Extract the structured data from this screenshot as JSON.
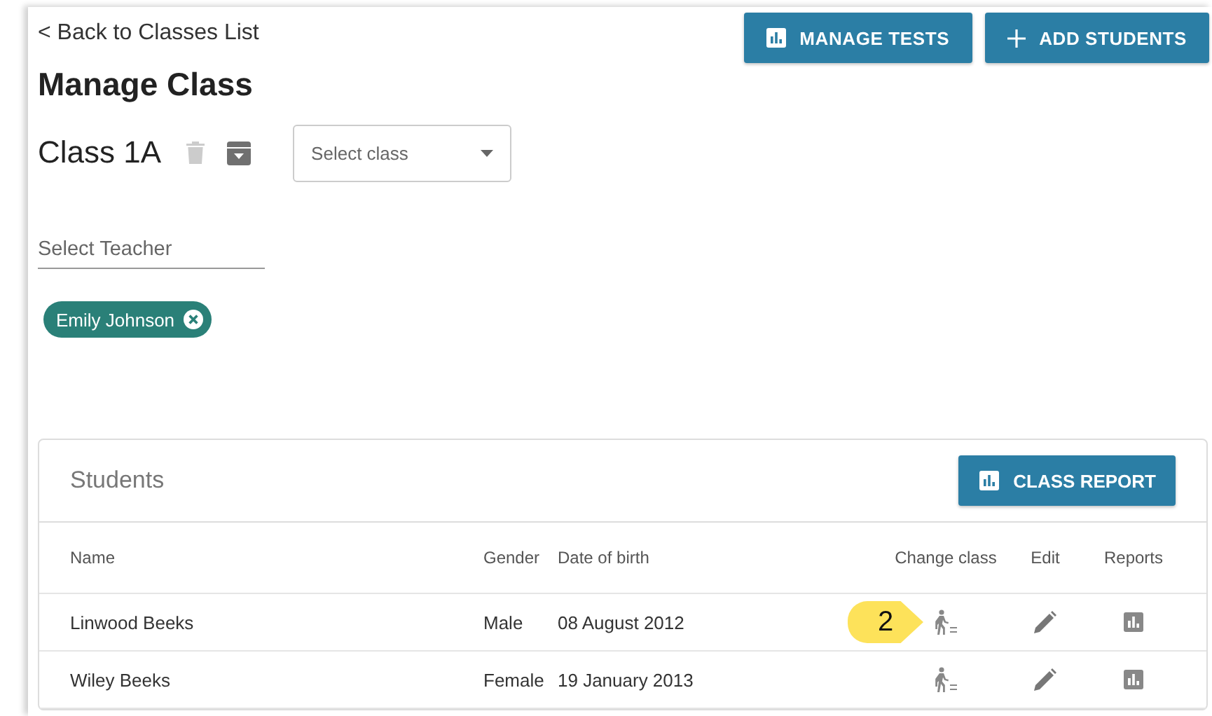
{
  "back_link": "< Back to Classes List",
  "header_buttons": [
    {
      "kind": "chart",
      "label": "MANAGE TESTS"
    },
    {
      "kind": "add",
      "label": "ADD STUDENTS"
    }
  ],
  "title": "Manage Class",
  "class_name": "Class 1A",
  "class_select": {
    "placeholder": "Select class"
  },
  "teacher_field": {
    "placeholder": "Select Teacher"
  },
  "teachers": [
    "Emily Johnson"
  ],
  "students": {
    "title": "Students",
    "report_button": "CLASS REPORT",
    "columns": [
      "Name",
      "Gender",
      "Date of birth",
      "Change class",
      "Edit",
      "Reports"
    ],
    "rows": [
      {
        "name": "Linwood Beeks",
        "gender": "Male",
        "dob": "08 August 2012",
        "callout": "2"
      },
      {
        "name": "Wiley Beeks",
        "gender": "Female",
        "dob": "19 January 2013"
      }
    ]
  }
}
